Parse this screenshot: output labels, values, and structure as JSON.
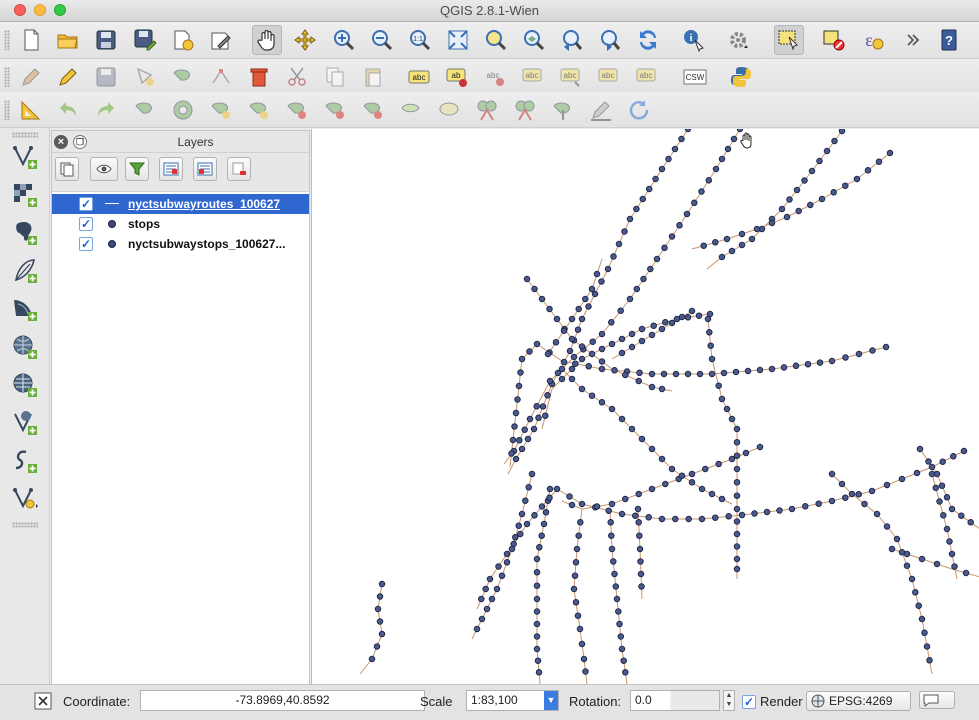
{
  "window": {
    "title": "QGIS 2.8.1-Wien"
  },
  "toolbar_row1": [
    {
      "icon": "new-project-icon"
    },
    {
      "icon": "open-project-icon"
    },
    {
      "icon": "save-project-icon"
    },
    {
      "icon": "save-as-icon"
    },
    {
      "icon": "new-print-composer-icon"
    },
    {
      "icon": "composer-manager-icon"
    },
    {
      "icon": "pan-map-icon"
    },
    {
      "icon": "pan-to-selection-icon"
    },
    {
      "icon": "zoom-in-icon"
    },
    {
      "icon": "zoom-out-icon"
    },
    {
      "icon": "zoom-actual-size-icon"
    },
    {
      "icon": "zoom-full-icon"
    },
    {
      "icon": "zoom-to-selection-icon"
    },
    {
      "icon": "zoom-to-layer-icon"
    },
    {
      "icon": "zoom-last-icon"
    },
    {
      "icon": "zoom-next-icon"
    },
    {
      "icon": "refresh-icon"
    },
    {
      "icon": "identify-icon"
    },
    {
      "icon": "run-action-icon"
    },
    {
      "icon": "select-features-icon"
    },
    {
      "icon": "deselect-icon"
    },
    {
      "icon": "field-calculator-icon"
    },
    {
      "icon": "overflow-chevron-icon"
    },
    {
      "icon": "help-icon"
    }
  ],
  "toolbar_row2": [
    {
      "icon": "digitize-pencil-icon"
    },
    {
      "icon": "toggle-editing-icon"
    },
    {
      "icon": "save-edits-icon"
    },
    {
      "icon": "add-feature-icon"
    },
    {
      "icon": "move-feature-icon"
    },
    {
      "icon": "node-tool-icon"
    },
    {
      "icon": "delete-selected-icon"
    },
    {
      "icon": "cut-features-icon"
    },
    {
      "icon": "copy-features-icon"
    },
    {
      "icon": "paste-features-icon"
    },
    {
      "icon": "label-toolbar-icon"
    },
    {
      "icon": "layer-labeling-icon"
    },
    {
      "icon": "pin-labels-icon"
    },
    {
      "icon": "show-hide-labels-icon"
    },
    {
      "icon": "move-label-icon"
    },
    {
      "icon": "rotate-label-icon"
    },
    {
      "icon": "change-label-icon"
    },
    {
      "icon": "csw-icon"
    },
    {
      "icon": "python-console-icon"
    }
  ],
  "toolbar_row3": [
    {
      "icon": "measure-tool-icon"
    },
    {
      "icon": "undo-icon"
    },
    {
      "icon": "redo-icon"
    },
    {
      "icon": "simplify-feature-icon"
    },
    {
      "icon": "add-ring-icon"
    },
    {
      "icon": "add-part-icon"
    },
    {
      "icon": "fill-ring-icon"
    },
    {
      "icon": "delete-ring-icon"
    },
    {
      "icon": "delete-part-icon"
    },
    {
      "icon": "offset-curve-icon"
    },
    {
      "icon": "reshape-features-icon"
    },
    {
      "icon": "split-features-icon"
    },
    {
      "icon": "split-parts-icon"
    },
    {
      "icon": "merge-features-icon"
    },
    {
      "icon": "merge-attributes-icon"
    },
    {
      "icon": "rotate-point-symbols-icon"
    },
    {
      "icon": "rotate-feature-icon"
    }
  ],
  "side_toolbar": [
    {
      "icon": "add-vector-layer-icon"
    },
    {
      "icon": "add-raster-layer-icon"
    },
    {
      "icon": "add-postgis-layer-icon"
    },
    {
      "icon": "add-spatialite-layer-icon"
    },
    {
      "icon": "add-mssql-layer-icon"
    },
    {
      "icon": "add-wms-layer-icon"
    },
    {
      "icon": "add-wcs-layer-icon"
    },
    {
      "icon": "add-wfs-layer-icon"
    },
    {
      "icon": "add-delimited-text-layer-icon"
    },
    {
      "icon": "new-shapefile-layer-icon"
    }
  ],
  "layers_panel": {
    "title": "Layers",
    "tools": [
      {
        "icon": "open-layer-styling-icon"
      },
      {
        "icon": "manage-visibility-icon"
      },
      {
        "icon": "filter-legend-icon"
      },
      {
        "icon": "expand-all-icon"
      },
      {
        "icon": "collapse-all-icon"
      },
      {
        "icon": "remove-layer-icon"
      }
    ],
    "layers": [
      {
        "name": "nyctsubwayroutes_100627",
        "checked": "✓",
        "symbol": "line",
        "selected": true
      },
      {
        "name": "stops",
        "checked": "✓",
        "symbol": "dot",
        "selected": false
      },
      {
        "name": "nyctsubwaystops_100627...",
        "checked": "✓",
        "symbol": "dot",
        "selected": false
      }
    ]
  },
  "map": {
    "route_color": "#c8956d",
    "stop_fill": "#4a5a8c",
    "stop_stroke": "#1c2244"
  },
  "statusbar": {
    "coordinate_label": "Coordinate:",
    "coordinate_value": "-73.8969,40.8592",
    "scale_label": "Scale",
    "scale_value": "1:83,100",
    "rotation_label": "Rotation:",
    "rotation_value": "0.0",
    "render_label": "Render",
    "render_checked": "✓",
    "crs_label": "EPSG:4269"
  }
}
